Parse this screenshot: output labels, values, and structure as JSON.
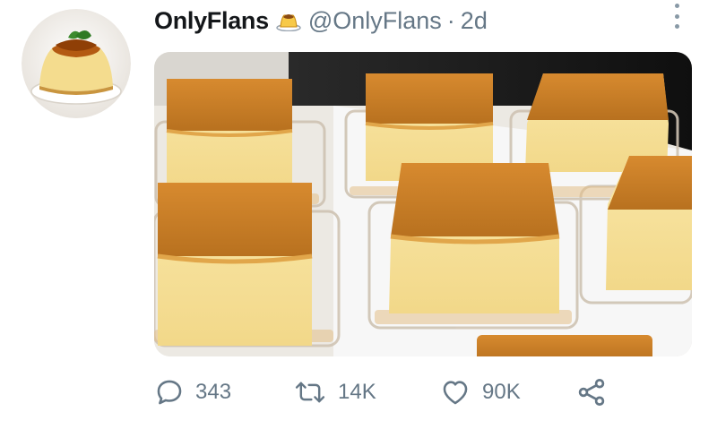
{
  "tweet": {
    "author": {
      "display_name": "OnlyFlans",
      "name_emoji": "flan-emoji",
      "handle": "@OnlyFlans",
      "separator": "·",
      "timestamp": "2d"
    },
    "media": {
      "subject": "flan-photo"
    },
    "actions": {
      "reply_count": "343",
      "retweet_count": "14K",
      "like_count": "90K"
    },
    "icons": {
      "reply": "comment-icon",
      "retweet": "retweet-icon",
      "like": "heart-icon",
      "share": "share-icon",
      "more": "more-vertical-icon"
    },
    "colors": {
      "text": "#14171a",
      "secondary": "#657786",
      "caramel": "#c7822a",
      "custard": "#f6e29a"
    }
  }
}
